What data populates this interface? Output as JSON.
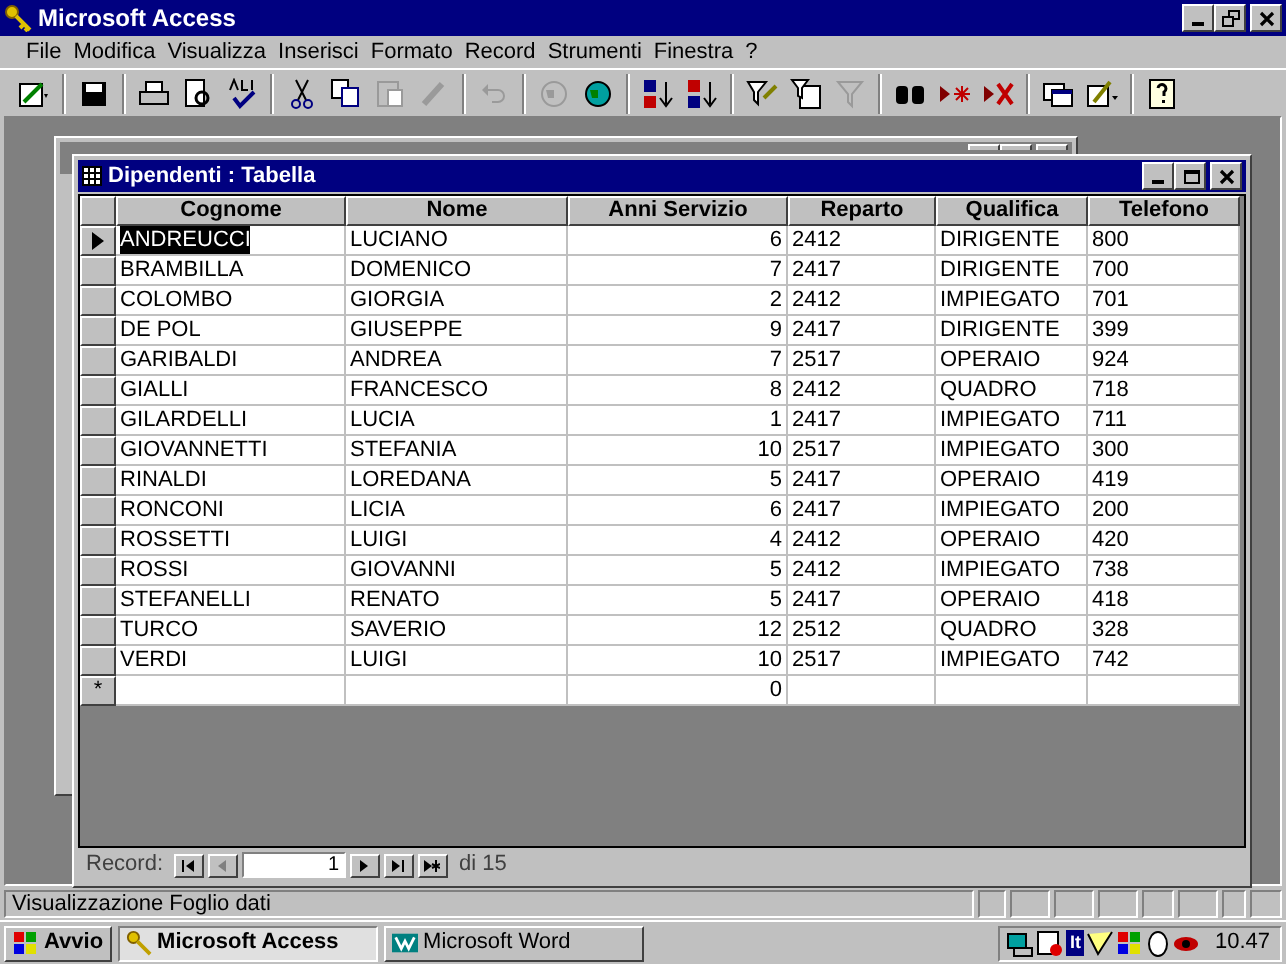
{
  "window": {
    "title": "Microsoft Access"
  },
  "menu": [
    {
      "label": "File"
    },
    {
      "label": "Modifica"
    },
    {
      "label": "Visualizza"
    },
    {
      "label": "Inserisci"
    },
    {
      "label": "Formato"
    },
    {
      "label": "Record"
    },
    {
      "label": "Strumenti"
    },
    {
      "label": "Finestra"
    },
    {
      "label": "?"
    }
  ],
  "toolbar": [
    {
      "kind": "design",
      "disabled": false
    },
    {
      "kind": "sep"
    },
    {
      "kind": "save",
      "disabled": false
    },
    {
      "kind": "sep"
    },
    {
      "kind": "print",
      "disabled": false
    },
    {
      "kind": "preview",
      "disabled": false
    },
    {
      "kind": "spell",
      "disabled": false
    },
    {
      "kind": "sep"
    },
    {
      "kind": "cut",
      "disabled": false
    },
    {
      "kind": "copy",
      "disabled": false
    },
    {
      "kind": "paste",
      "disabled": true
    },
    {
      "kind": "brush",
      "disabled": true
    },
    {
      "kind": "sep"
    },
    {
      "kind": "undo",
      "disabled": true
    },
    {
      "kind": "sep"
    },
    {
      "kind": "globe",
      "disabled": true
    },
    {
      "kind": "globe",
      "disabled": false
    },
    {
      "kind": "sep"
    },
    {
      "kind": "sortaz",
      "disabled": false
    },
    {
      "kind": "sortza",
      "disabled": false
    },
    {
      "kind": "sep"
    },
    {
      "kind": "filter",
      "disabled": false
    },
    {
      "kind": "filterform",
      "disabled": false
    },
    {
      "kind": "funnel",
      "disabled": true
    },
    {
      "kind": "sep"
    },
    {
      "kind": "find",
      "disabled": false
    },
    {
      "kind": "newrec",
      "disabled": false
    },
    {
      "kind": "delrec",
      "disabled": false
    },
    {
      "kind": "sep"
    },
    {
      "kind": "window",
      "disabled": false
    },
    {
      "kind": "objects",
      "disabled": false
    },
    {
      "kind": "sep"
    },
    {
      "kind": "help",
      "disabled": false
    }
  ],
  "table_window": {
    "title": "Dipendenti : Tabella"
  },
  "table": {
    "columns": [
      "Cognome",
      "Nome",
      "Anni Servizio",
      "Reparto",
      "Qualifica",
      "Telefono"
    ],
    "rows": [
      {
        "selected": true,
        "cells": [
          "ANDREUCCI",
          "LUCIANO",
          "6",
          "2412",
          "DIRIGENTE",
          "800"
        ]
      },
      {
        "selected": false,
        "cells": [
          "BRAMBILLA",
          "DOMENICO",
          "7",
          "2417",
          "DIRIGENTE",
          "700"
        ]
      },
      {
        "selected": false,
        "cells": [
          "COLOMBO",
          "GIORGIA",
          "2",
          "2412",
          "IMPIEGATO",
          "701"
        ]
      },
      {
        "selected": false,
        "cells": [
          "DE POL",
          "GIUSEPPE",
          "9",
          "2417",
          "DIRIGENTE",
          "399"
        ]
      },
      {
        "selected": false,
        "cells": [
          "GARIBALDI",
          "ANDREA",
          "7",
          "2517",
          "OPERAIO",
          "924"
        ]
      },
      {
        "selected": false,
        "cells": [
          "GIALLI",
          "FRANCESCO",
          "8",
          "2412",
          "QUADRO",
          "718"
        ]
      },
      {
        "selected": false,
        "cells": [
          "GILARDELLI",
          "LUCIA",
          "1",
          "2417",
          "IMPIEGATO",
          "711"
        ]
      },
      {
        "selected": false,
        "cells": [
          "GIOVANNETTI",
          "STEFANIA",
          "10",
          "2517",
          "IMPIEGATO",
          "300"
        ]
      },
      {
        "selected": false,
        "cells": [
          "RINALDI",
          "LOREDANA",
          "5",
          "2417",
          "OPERAIO",
          "419"
        ]
      },
      {
        "selected": false,
        "cells": [
          "RONCONI",
          "LICIA",
          "6",
          "2417",
          "IMPIEGATO",
          "200"
        ]
      },
      {
        "selected": false,
        "cells": [
          "ROSSETTI",
          "LUIGI",
          "4",
          "2412",
          "OPERAIO",
          "420"
        ]
      },
      {
        "selected": false,
        "cells": [
          "ROSSI",
          "GIOVANNI",
          "5",
          "2412",
          "IMPIEGATO",
          "738"
        ]
      },
      {
        "selected": false,
        "cells": [
          "STEFANELLI",
          "RENATO",
          "5",
          "2417",
          "OPERAIO",
          "418"
        ]
      },
      {
        "selected": false,
        "cells": [
          "TURCO",
          "SAVERIO",
          "12",
          "2512",
          "QUADRO",
          "328"
        ]
      },
      {
        "selected": false,
        "cells": [
          "VERDI",
          "LUIGI",
          "10",
          "2517",
          "IMPIEGATO",
          "742"
        ]
      }
    ],
    "new_row": {
      "marker": "*",
      "cells": [
        "",
        "",
        "0",
        "",
        "",
        ""
      ]
    }
  },
  "navigator": {
    "label": "Record:",
    "current": "1",
    "total": "di 15"
  },
  "status_bar": {
    "text": "Visualizzazione Foglio dati"
  },
  "taskbar": {
    "start": "Avvio",
    "tasks": [
      {
        "label": "Microsoft Access",
        "selected": true,
        "kind": "access"
      },
      {
        "label": "Microsoft Word",
        "selected": false,
        "kind": "word"
      }
    ],
    "language": "It",
    "clock": "10.47"
  }
}
